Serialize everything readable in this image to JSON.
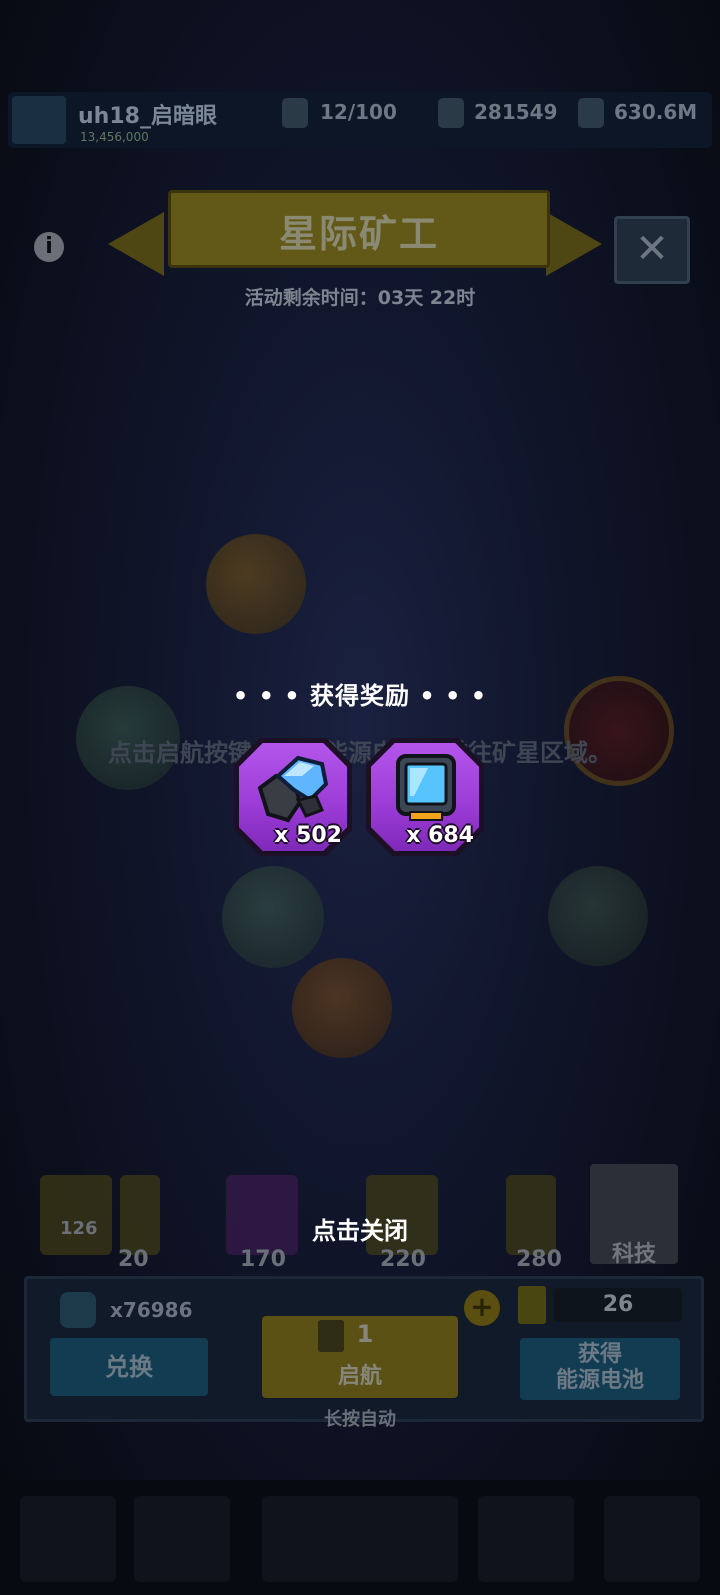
{
  "header": {
    "player_name": "uh18_启暗眼",
    "player_score": "13,456,000",
    "stats": [
      "12/100",
      "281549",
      "630.6M"
    ]
  },
  "event": {
    "title": "星际矿工",
    "timer": "活动剩余时间：03天 22时",
    "hint": "点击启航按键，消耗能源电池，前往矿星区域。",
    "close_symbol": "✕",
    "info_symbol": "i"
  },
  "shop": {
    "prices": [
      "126",
      "20",
      "170",
      "220",
      "280"
    ],
    "tech_label": "科技"
  },
  "launch_panel": {
    "ore_count": "x76986",
    "exchange_label": "兑换",
    "launch_count": "1",
    "launch_label": "启航",
    "hold_hint": "长按自动",
    "battery_count": "26",
    "get_battery_label_1": "获得",
    "get_battery_label_2": "能源电池",
    "plus_symbol": "+"
  },
  "reward_popup": {
    "title": "• • •  获得奖励  • • •",
    "items": [
      {
        "icon": "blue-ore-icon",
        "qty": "x 502"
      },
      {
        "icon": "energy-crystal-card-icon",
        "qty": "x 684"
      }
    ],
    "close_hint": "点击关闭"
  },
  "colors": {
    "card_purple": "#9a3bd6",
    "overlay_dim": "#07090f"
  }
}
